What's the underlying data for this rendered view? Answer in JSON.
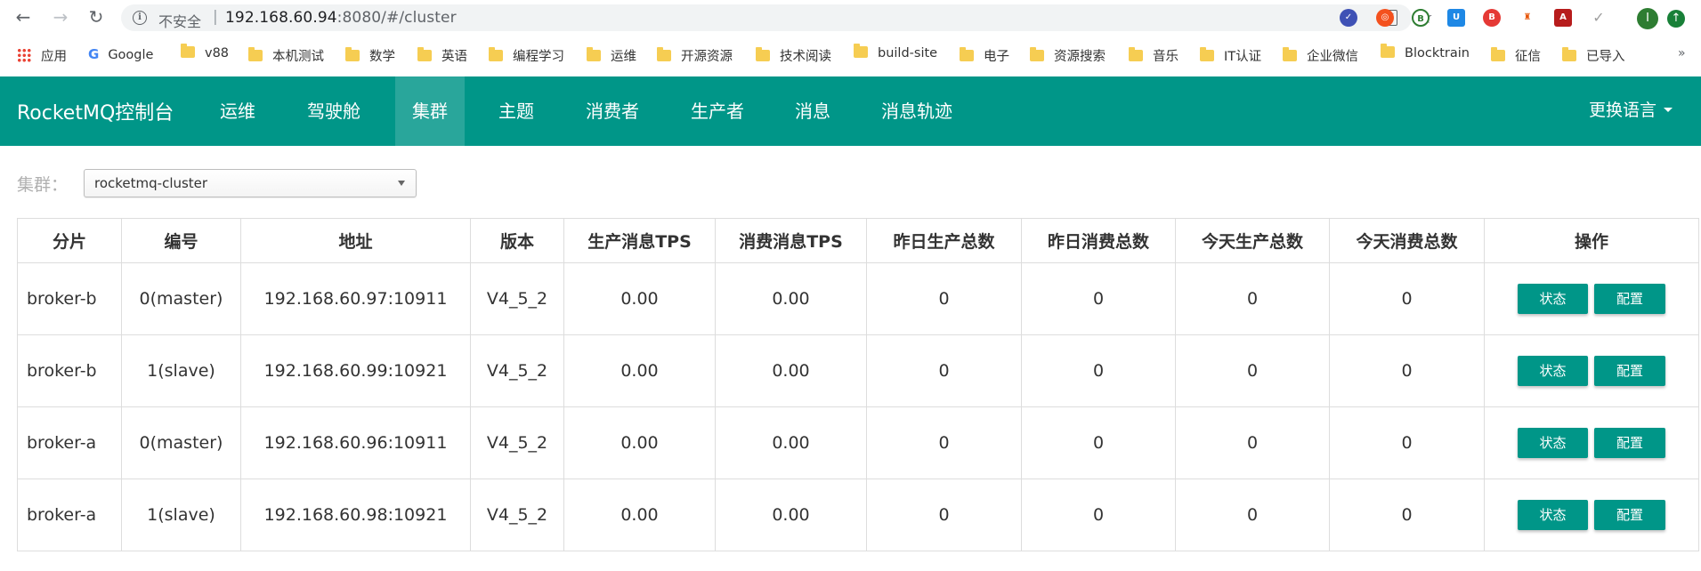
{
  "browser": {
    "insecure_label": "不安全",
    "separator": "|",
    "url_host": "192.168.60.94",
    "url_rest": ":8080/#/cluster",
    "profile_initial": "I"
  },
  "bookmarks": {
    "items": [
      {
        "label": "应用",
        "icon": "apps-icon"
      },
      {
        "label": "Google",
        "icon": "google-icon"
      },
      {
        "label": "v88",
        "icon": "folder-icon"
      },
      {
        "label": "本机测试",
        "icon": "folder-icon"
      },
      {
        "label": "数学",
        "icon": "folder-icon"
      },
      {
        "label": "英语",
        "icon": "folder-icon"
      },
      {
        "label": "编程学习",
        "icon": "folder-icon"
      },
      {
        "label": "运维",
        "icon": "folder-icon"
      },
      {
        "label": "开源资源",
        "icon": "folder-icon"
      },
      {
        "label": "技术阅读",
        "icon": "folder-icon"
      },
      {
        "label": "build-site",
        "icon": "folder-icon"
      },
      {
        "label": "电子",
        "icon": "folder-icon"
      },
      {
        "label": "资源搜索",
        "icon": "folder-icon"
      },
      {
        "label": "音乐",
        "icon": "folder-icon"
      },
      {
        "label": "IT认证",
        "icon": "folder-icon"
      },
      {
        "label": "企业微信",
        "icon": "folder-icon"
      },
      {
        "label": "Blocktrain",
        "icon": "folder-icon"
      },
      {
        "label": "征信",
        "icon": "folder-icon"
      },
      {
        "label": "已导入",
        "icon": "folder-icon"
      }
    ],
    "more": "»"
  },
  "navbar": {
    "brand": "RocketMQ控制台",
    "items": [
      {
        "label": "运维"
      },
      {
        "label": "驾驶舱"
      },
      {
        "label": "集群"
      },
      {
        "label": "主题"
      },
      {
        "label": "消费者"
      },
      {
        "label": "生产者"
      },
      {
        "label": "消息"
      },
      {
        "label": "消息轨迹"
      }
    ],
    "active": "集群",
    "language": "更换语言"
  },
  "cluster": {
    "label": "集群：",
    "selected": "rocketmq-cluster"
  },
  "table": {
    "headers": [
      "分片",
      "编号",
      "地址",
      "版本",
      "生产消息TPS",
      "消费消息TPS",
      "昨日生产总数",
      "昨日消费总数",
      "今天生产总数",
      "今天消费总数",
      "操作"
    ],
    "rows": [
      {
        "shard": "broker-b",
        "id": "0(master)",
        "address": "192.168.60.97:10911",
        "version": "V4_5_2",
        "produce_tps": "0.00",
        "consume_tps": "0.00",
        "yesterday_produce": "0",
        "yesterday_consume": "0",
        "today_produce": "0",
        "today_consume": "0"
      },
      {
        "shard": "broker-b",
        "id": "1(slave)",
        "address": "192.168.60.99:10921",
        "version": "V4_5_2",
        "produce_tps": "0.00",
        "consume_tps": "0.00",
        "yesterday_produce": "0",
        "yesterday_consume": "0",
        "today_produce": "0",
        "today_consume": "0"
      },
      {
        "shard": "broker-a",
        "id": "0(master)",
        "address": "192.168.60.96:10911",
        "version": "V4_5_2",
        "produce_tps": "0.00",
        "consume_tps": "0.00",
        "yesterday_produce": "0",
        "yesterday_consume": "0",
        "today_produce": "0",
        "today_consume": "0"
      },
      {
        "shard": "broker-a",
        "id": "1(slave)",
        "address": "192.168.60.98:10921",
        "version": "V4_5_2",
        "produce_tps": "0.00",
        "consume_tps": "0.00",
        "yesterday_produce": "0",
        "yesterday_consume": "0",
        "today_produce": "0",
        "today_consume": "0"
      }
    ],
    "status_button": "状态",
    "config_button": "配置"
  },
  "colors": {
    "accent": "#009688"
  }
}
